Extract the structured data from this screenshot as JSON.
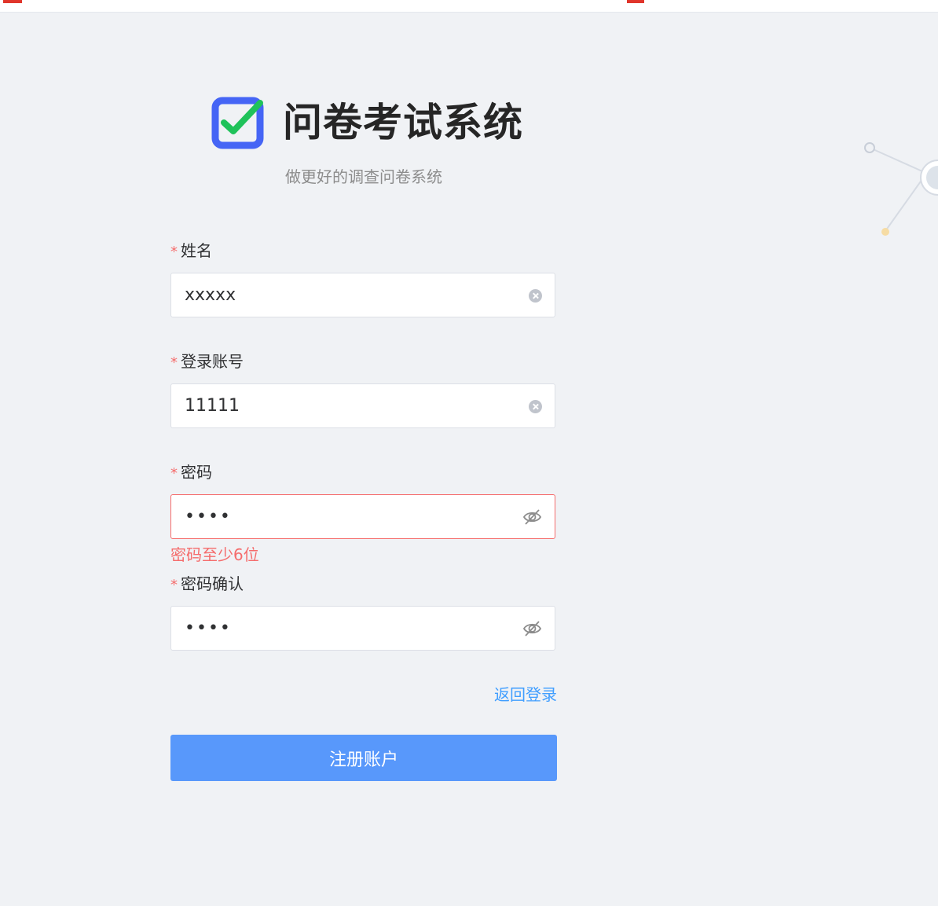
{
  "brand": {
    "title": "问卷考试系统",
    "subtitle": "做更好的调查问卷系统",
    "logo_icon": "checkbox-check-icon"
  },
  "form": {
    "name": {
      "label": "姓名",
      "value": "xxxxx"
    },
    "account": {
      "label": "登录账号",
      "value": "11111"
    },
    "password": {
      "label": "密码",
      "value": "1234",
      "error": "密码至少6位"
    },
    "password_confirm": {
      "label": "密码确认",
      "value": "1234"
    },
    "required_mark": "*",
    "back_to_login": "返回登录",
    "submit_label": "注册账户"
  },
  "colors": {
    "primary": "#5898fb",
    "link": "#409eff",
    "error": "#f56c6c",
    "logo_blue": "#4565f5",
    "logo_green": "#1fc25a",
    "background": "#f0f2f5"
  }
}
